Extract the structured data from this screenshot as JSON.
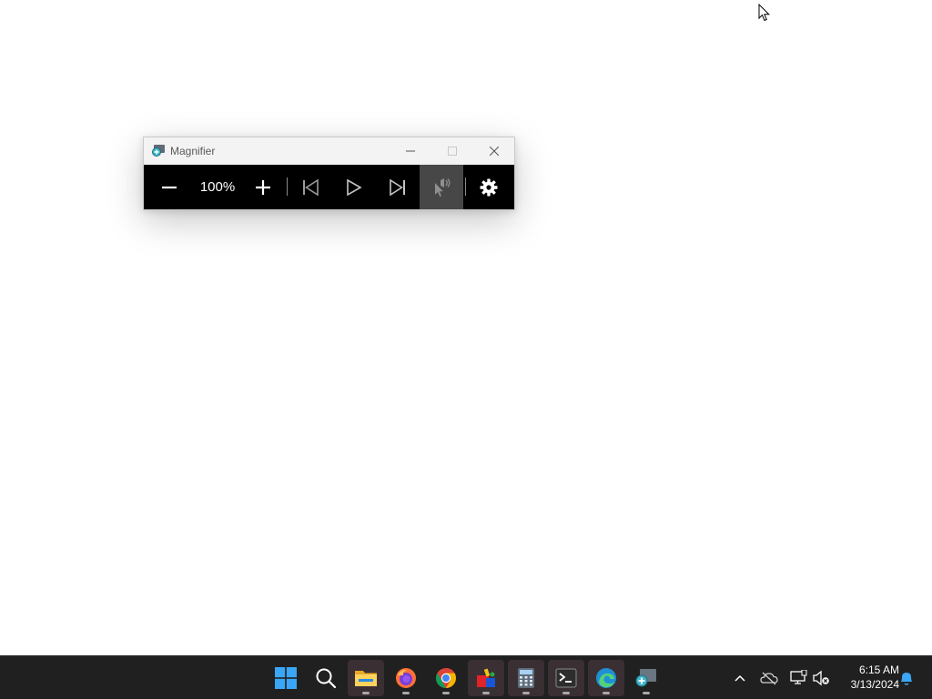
{
  "magnifier": {
    "title": "Magnifier",
    "zoom_level": "100%",
    "toolbar": {
      "zoom_out": "zoom-out",
      "zoom_in": "zoom-in",
      "previous_paragraph": "previous",
      "play": "play",
      "next_paragraph": "next",
      "read_from_here": "read-from-here",
      "settings": "settings"
    }
  },
  "taskbar": {
    "pinned": [
      {
        "name": "start",
        "icon": "windows-logo-icon"
      },
      {
        "name": "search",
        "icon": "search-icon"
      },
      {
        "name": "file-explorer",
        "icon": "folder-icon",
        "running": true
      },
      {
        "name": "firefox",
        "icon": "firefox-icon",
        "running": true
      },
      {
        "name": "chrome",
        "icon": "chrome-icon",
        "running": true
      },
      {
        "name": "paint",
        "icon": "paint-icon",
        "running": true
      },
      {
        "name": "calculator",
        "icon": "calculator-icon",
        "running": true
      },
      {
        "name": "terminal",
        "icon": "terminal-icon",
        "running": true
      },
      {
        "name": "edge",
        "icon": "edge-icon",
        "running": true
      },
      {
        "name": "magnifier",
        "icon": "magnifier-icon",
        "running": true
      }
    ],
    "clock": {
      "time": "6:15 AM",
      "date": "3/13/2024"
    }
  },
  "colors": {
    "accent": "#0078d4",
    "taskbar": "#202020",
    "toolbar": "#000000"
  }
}
